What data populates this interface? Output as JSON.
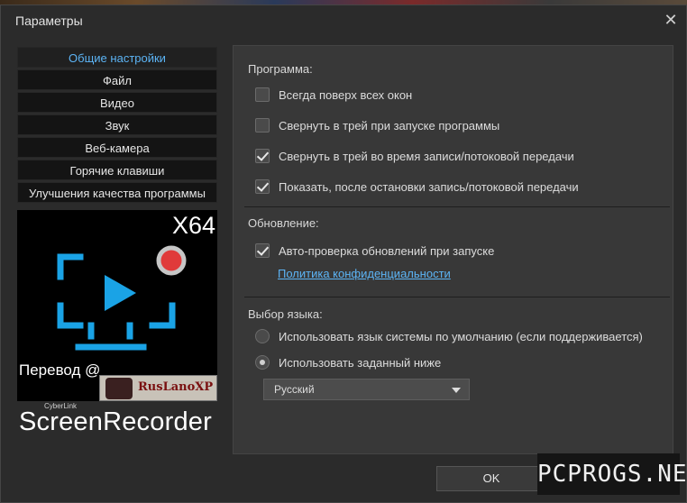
{
  "window": {
    "title": "Параметры"
  },
  "nav": {
    "items": [
      {
        "label": "Общие настройки"
      },
      {
        "label": "Файл"
      },
      {
        "label": "Видео"
      },
      {
        "label": "Звук"
      },
      {
        "label": "Веб-камера"
      },
      {
        "label": "Горячие клавиши"
      },
      {
        "label": "Улучшения качества программы"
      }
    ]
  },
  "banner": {
    "arch": "X64",
    "translation_label": "Перевод @",
    "stamp_text": "RusLanoXP",
    "logo_brand": "CyberLink",
    "logo_product": "ScreenRecorder"
  },
  "program": {
    "title": "Программа:",
    "options": [
      {
        "label": "Всегда поверх всех окон",
        "checked": false
      },
      {
        "label": "Свернуть в трей при запуске программы",
        "checked": false
      },
      {
        "label": "Свернуть в трей во время записи/потоковой передачи",
        "checked": true
      },
      {
        "label": "Показать, после остановки запись/потоковой передачи",
        "checked": true
      }
    ]
  },
  "update": {
    "title": "Обновление:",
    "auto_check_label": "Авто-проверка обновлений при запуске",
    "auto_check": true,
    "privacy_link": "Политика конфиденциальности"
  },
  "language": {
    "title": "Выбор языка:",
    "system_label": "Использовать язык системы по умолчанию (если поддерживается)",
    "custom_label": "Использовать заданный ниже",
    "selected": "Русский"
  },
  "buttons": {
    "ok": "OK"
  },
  "watermark": "PCPROGS.NET",
  "colors": {
    "accent": "#5cb4f5",
    "icon_blue": "#1aa3e6",
    "record_red": "#e03a3a"
  }
}
